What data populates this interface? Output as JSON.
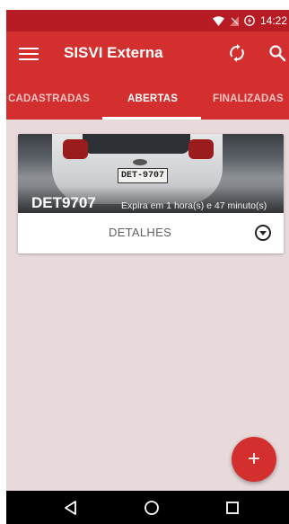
{
  "status_bar": {
    "time": "14:22"
  },
  "app_bar": {
    "title": "SISVI Externa"
  },
  "tabs": [
    {
      "label": "CADASTRADAS"
    },
    {
      "label": "ABERTAS"
    },
    {
      "label": "FINALIZADAS"
    }
  ],
  "card": {
    "plate_in_photo": "DET-9707",
    "plate": "DET9707",
    "expires": "Expira em 1 hora(s) e 47 minuto(s)",
    "action_label": "DETALHES"
  },
  "fab": {
    "label": "+"
  },
  "colors": {
    "primary": "#d32f2f",
    "status_bar": "#b71c24",
    "background": "#e8dada"
  }
}
